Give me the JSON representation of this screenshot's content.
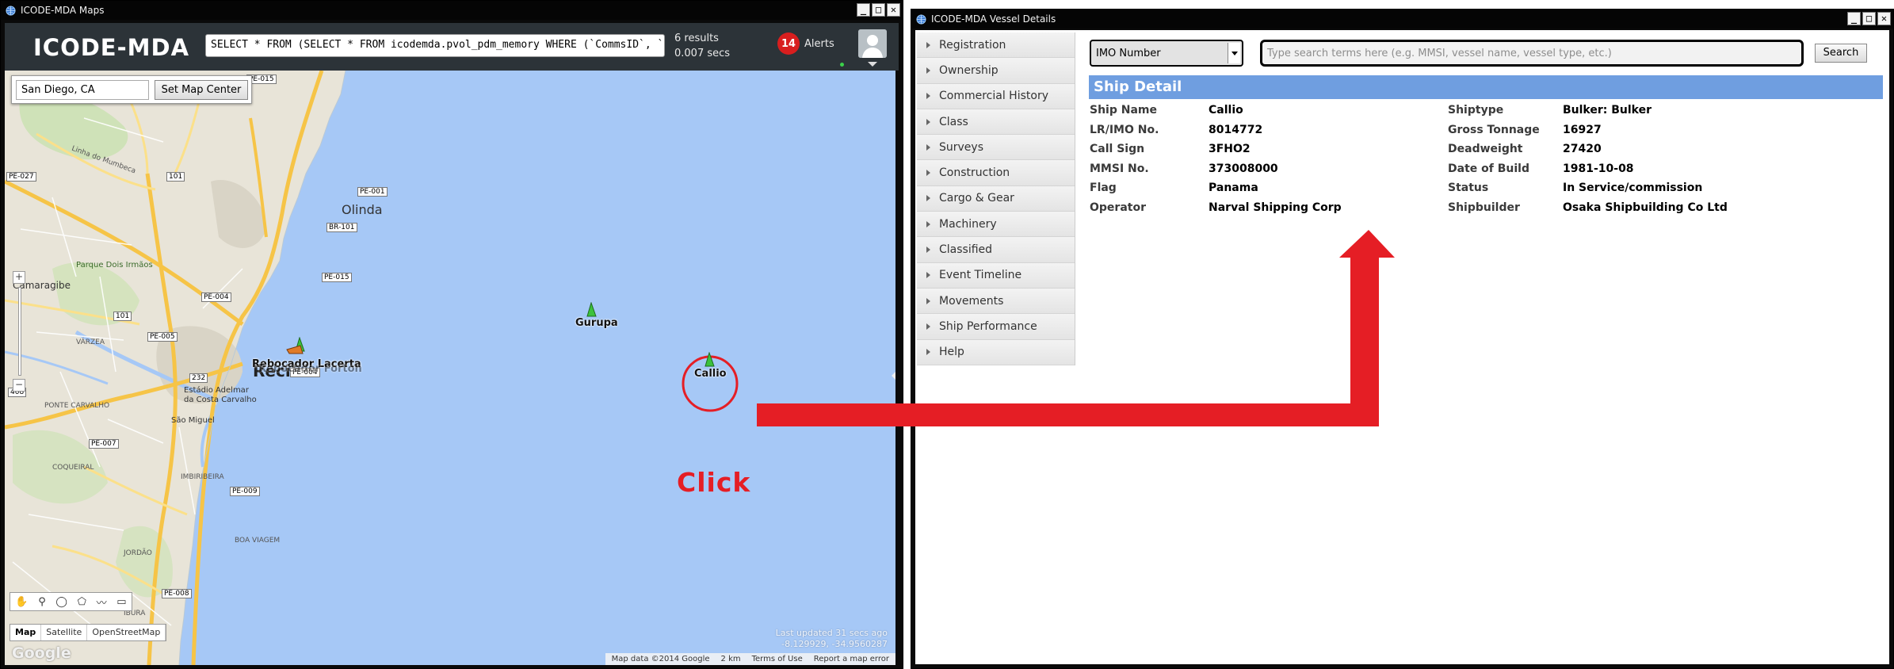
{
  "maps_window": {
    "title": "ICODE-MDA Maps",
    "brand": "ICODE-MDA",
    "query": "SELECT * FROM (SELECT * FROM icodemda.pvol_pdm_memory WHERE (`CommsID`, `",
    "results_count": "6 results",
    "results_time": "0.007 secs",
    "alerts_count": "14",
    "alerts_label": "Alerts",
    "map_center_value": "San Diego, CA",
    "set_center_label": "Set Map Center",
    "map_types": [
      "Map",
      "Satellite",
      "OpenStreetMap"
    ],
    "last_updated_line1": "Last updated 31 secs ago",
    "last_updated_line2": "-8.129929, -34.9560287",
    "attribution": [
      "Map data ©2014 Google",
      "2 km",
      "Terms of Use",
      "Report a map error"
    ],
    "google_label": "Google",
    "click_annotation": "Click",
    "places": {
      "olinda": "Olinda",
      "recife": "Recife",
      "camaragibe": "Camaragibe",
      "parque_dois_irmaos": "Parque Dois Irmãos",
      "estadio": "Estádio Adelmar da Costa Carvalho",
      "sao_miguel": "São Miguel",
      "coqueiral": "COQUEIRAL",
      "imbiribeira": "IMBIRIBEIRA",
      "boa_viagem": "BOA VIAGEM",
      "varzea": "VÁRZEA",
      "ibura": "IBURA",
      "linha_do_mumbeca": "Linha do Mumbeca",
      "ponte_carvalho": "PONTE CARVALHO",
      "jordao": "JORDÃO"
    },
    "roads": [
      "PE-015",
      "PE-001",
      "PE-004",
      "PE-005",
      "PE-007",
      "PE-008",
      "PE-009",
      "BR-101",
      "PE-015",
      "PE-027",
      "101",
      "232",
      "101",
      "408",
      "PE-004"
    ],
    "ships": [
      {
        "name": "Gurupa",
        "color": "#3cc23c"
      },
      {
        "name": "Callio",
        "color": "#3cc23c"
      },
      {
        "name": "Rebocador Lacerta",
        "color": "#3cc23c"
      },
      {
        "name": "Rebocador Fortoh",
        "color": "#e07b28"
      }
    ],
    "highlight_color": "#e51e25"
  },
  "vessel_window": {
    "title": "ICODE-MDA Vessel Details",
    "menu": [
      "Registration",
      "Ownership",
      "Commercial History",
      "Class",
      "Surveys",
      "Construction",
      "Cargo & Gear",
      "Machinery",
      "Classified",
      "Event Timeline",
      "Movements",
      "Ship Performance",
      "Help"
    ],
    "search_type": "IMO Number",
    "search_placeholder": "Type search terms here (e.g. MMSI, vessel name, vessel type, etc.)",
    "search_button": "Search",
    "detail_title": "Ship Detail",
    "details": [
      {
        "label1": "Ship Name",
        "value1": "Callio",
        "label2": "Shiptype",
        "value2": "Bulker: Bulker"
      },
      {
        "label1": "LR/IMO No.",
        "value1": "8014772",
        "label2": "Gross Tonnage",
        "value2": "16927"
      },
      {
        "label1": "Call Sign",
        "value1": "3FHO2",
        "label2": "Deadweight",
        "value2": "27420"
      },
      {
        "label1": "MMSI No.",
        "value1": "373008000",
        "label2": "Date of Build",
        "value2": "1981-10-08"
      },
      {
        "label1": "Flag",
        "value1": "Panama",
        "label2": "Status",
        "value2": "In Service/commission"
      },
      {
        "label1": "Operator",
        "value1": "Narval Shipping Corp",
        "label2": "Shipbuilder",
        "value2": "Osaka Shipbuilding Co Ltd"
      }
    ],
    "accent_color": "#6f9ee0"
  },
  "window_controls": {
    "minimize": "_",
    "maximize": "□",
    "close": "✕"
  }
}
